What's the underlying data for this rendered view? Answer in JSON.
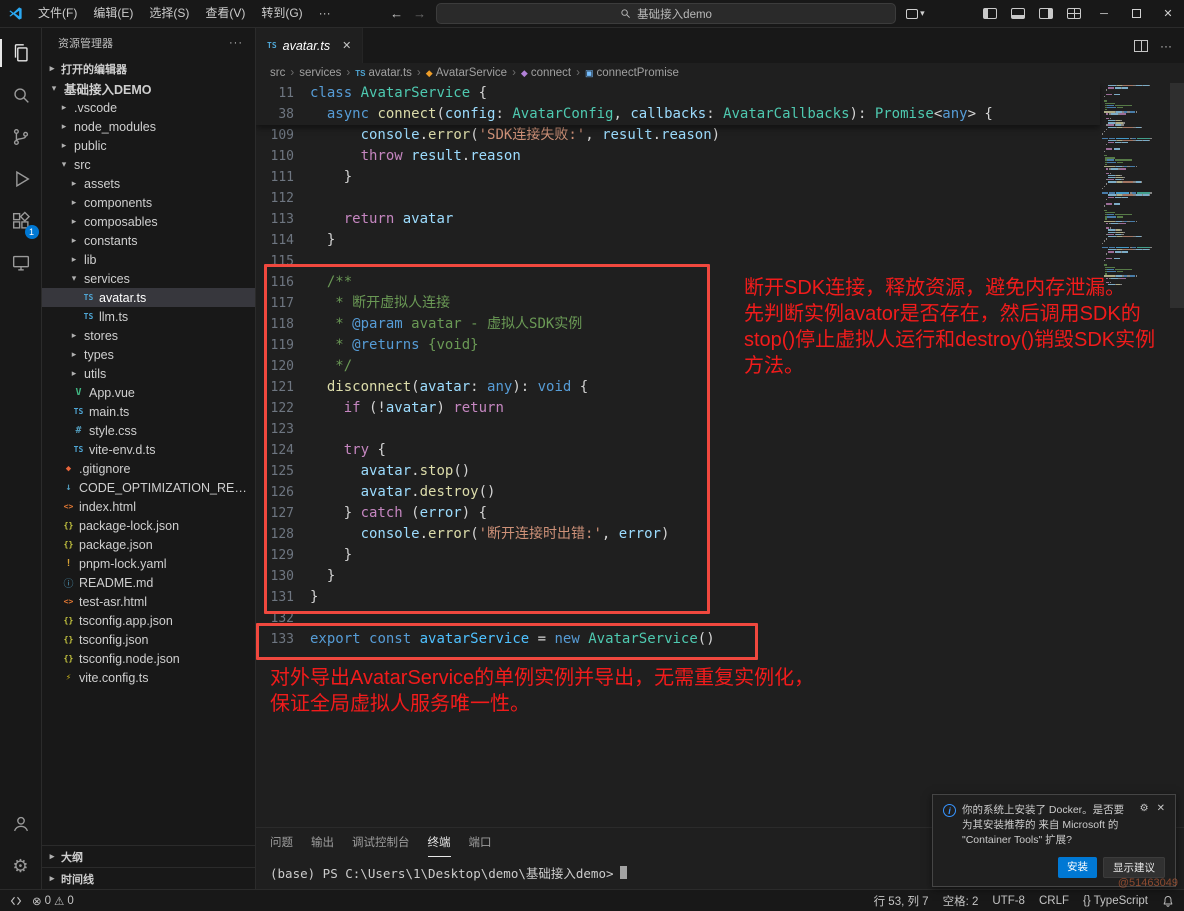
{
  "titlebar": {
    "menus": [
      "文件(F)",
      "编辑(E)",
      "选择(S)",
      "查看(V)",
      "转到(G)",
      "···"
    ],
    "search_text": "基础接入demo"
  },
  "glyphs": {
    "back": "←",
    "forward": "→",
    "more": "···",
    "close": "✕",
    "minimize": "─",
    "chev_c": "▸",
    "chev_e": "▾",
    "crumb_sep": "›",
    "err": "⊗",
    "warn": "⚠",
    "ts": "TS",
    "gear": "⚙",
    "dropdown": "▾"
  },
  "activity_bar": {
    "extensions_badge": "1"
  },
  "sidebar": {
    "title": "资源管理器",
    "open_editors_label": "打开的编辑器",
    "outline_label": "大纲",
    "timeline_label": "时间线",
    "tree": [
      {
        "label": "基础接入DEMO",
        "depth": 0,
        "kind": "folder",
        "state": "expanded",
        "bold": true
      },
      {
        "label": ".vscode",
        "depth": 1,
        "kind": "folder",
        "state": "collapsed"
      },
      {
        "label": "node_modules",
        "depth": 1,
        "kind": "folder",
        "state": "collapsed"
      },
      {
        "label": "public",
        "depth": 1,
        "kind": "folder",
        "state": "collapsed"
      },
      {
        "label": "src",
        "depth": 1,
        "kind": "folder",
        "state": "expanded"
      },
      {
        "label": "assets",
        "depth": 2,
        "kind": "folder",
        "state": "collapsed"
      },
      {
        "label": "components",
        "depth": 2,
        "kind": "folder",
        "state": "collapsed"
      },
      {
        "label": "composables",
        "depth": 2,
        "kind": "folder",
        "state": "collapsed"
      },
      {
        "label": "constants",
        "depth": 2,
        "kind": "folder",
        "state": "collapsed"
      },
      {
        "label": "lib",
        "depth": 2,
        "kind": "folder",
        "state": "collapsed"
      },
      {
        "label": "services",
        "depth": 2,
        "kind": "folder",
        "state": "expanded"
      },
      {
        "label": "avatar.ts",
        "depth": 3,
        "kind": "file",
        "icon": "ts",
        "selected": true
      },
      {
        "label": "llm.ts",
        "depth": 3,
        "kind": "file",
        "icon": "ts"
      },
      {
        "label": "stores",
        "depth": 2,
        "kind": "folder",
        "state": "collapsed"
      },
      {
        "label": "types",
        "depth": 2,
        "kind": "folder",
        "state": "collapsed"
      },
      {
        "label": "utils",
        "depth": 2,
        "kind": "folder",
        "state": "collapsed"
      },
      {
        "label": "App.vue",
        "depth": 2,
        "kind": "file",
        "icon": "vue"
      },
      {
        "label": "main.ts",
        "depth": 2,
        "kind": "file",
        "icon": "ts"
      },
      {
        "label": "style.css",
        "depth": 2,
        "kind": "file",
        "icon": "css"
      },
      {
        "label": "vite-env.d.ts",
        "depth": 2,
        "kind": "file",
        "icon": "ts"
      },
      {
        "label": ".gitignore",
        "depth": 1,
        "kind": "file",
        "icon": "git"
      },
      {
        "label": "CODE_OPTIMIZATION_REPORT.md",
        "depth": 1,
        "kind": "file",
        "icon": "md"
      },
      {
        "label": "index.html",
        "depth": 1,
        "kind": "file",
        "icon": "html"
      },
      {
        "label": "package-lock.json",
        "depth": 1,
        "kind": "file",
        "icon": "json"
      },
      {
        "label": "package.json",
        "depth": 1,
        "kind": "file",
        "icon": "json"
      },
      {
        "label": "pnpm-lock.yaml",
        "depth": 1,
        "kind": "file",
        "icon": "yaml"
      },
      {
        "label": "README.md",
        "depth": 1,
        "kind": "file",
        "icon": "readme"
      },
      {
        "label": "test-asr.html",
        "depth": 1,
        "kind": "file",
        "icon": "html"
      },
      {
        "label": "tsconfig.app.json",
        "depth": 1,
        "kind": "file",
        "icon": "json"
      },
      {
        "label": "tsconfig.json",
        "depth": 1,
        "kind": "file",
        "icon": "json"
      },
      {
        "label": "tsconfig.node.json",
        "depth": 1,
        "kind": "file",
        "icon": "json"
      },
      {
        "label": "vite.config.ts",
        "depth": 1,
        "kind": "file",
        "icon": "vite"
      }
    ]
  },
  "editor": {
    "tab": {
      "label": "avatar.ts"
    },
    "breadcrumbs": [
      {
        "label": "src"
      },
      {
        "label": "services"
      },
      {
        "label": "avatar.ts",
        "icon": "ts"
      },
      {
        "label": "AvatarService",
        "icon": "class"
      },
      {
        "label": "connect",
        "icon": "method"
      },
      {
        "label": "connectPromise",
        "icon": "field"
      }
    ],
    "sticky_lines": [
      {
        "num": "11",
        "tokens": [
          [
            "kw",
            "class"
          ],
          [
            "pln",
            " "
          ],
          [
            "type",
            "AvatarService"
          ],
          [
            "pln",
            " {"
          ]
        ]
      },
      {
        "num": "38",
        "tokens": [
          [
            "pln",
            "  "
          ],
          [
            "kw",
            "async"
          ],
          [
            "pln",
            " "
          ],
          [
            "fn",
            "connect"
          ],
          [
            "pln",
            "("
          ],
          [
            "var",
            "config"
          ],
          [
            "pln",
            ": "
          ],
          [
            "type",
            "AvatarConfig"
          ],
          [
            "pln",
            ", "
          ],
          [
            "var",
            "callbacks"
          ],
          [
            "pln",
            ": "
          ],
          [
            "type",
            "AvatarCallbacks"
          ],
          [
            "pln",
            "): "
          ],
          [
            "type",
            "Promise"
          ],
          [
            "pln",
            "<"
          ],
          [
            "kw",
            "any"
          ],
          [
            "pln",
            "> {"
          ]
        ]
      }
    ],
    "code_lines": [
      {
        "num": "109",
        "tokens": [
          [
            "pln",
            "      "
          ],
          [
            "var",
            "console"
          ],
          [
            "pln",
            "."
          ],
          [
            "fn",
            "error"
          ],
          [
            "pln",
            "("
          ],
          [
            "str",
            "'SDK连接失败:'"
          ],
          [
            "pln",
            ", "
          ],
          [
            "var",
            "result"
          ],
          [
            "pln",
            "."
          ],
          [
            "var",
            "reason"
          ],
          [
            "pln",
            ")"
          ]
        ]
      },
      {
        "num": "110",
        "tokens": [
          [
            "pln",
            "      "
          ],
          [
            "ctrl",
            "throw"
          ],
          [
            "pln",
            " "
          ],
          [
            "var",
            "result"
          ],
          [
            "pln",
            "."
          ],
          [
            "var",
            "reason"
          ]
        ]
      },
      {
        "num": "111",
        "tokens": [
          [
            "pln",
            "    }"
          ]
        ]
      },
      {
        "num": "112",
        "tokens": []
      },
      {
        "num": "113",
        "tokens": [
          [
            "pln",
            "    "
          ],
          [
            "ctrl",
            "return"
          ],
          [
            "pln",
            " "
          ],
          [
            "var",
            "avatar"
          ]
        ]
      },
      {
        "num": "114",
        "tokens": [
          [
            "pln",
            "  }"
          ]
        ]
      },
      {
        "num": "115",
        "tokens": []
      },
      {
        "num": "116",
        "tokens": [
          [
            "cmt",
            "  /**"
          ]
        ]
      },
      {
        "num": "117",
        "tokens": [
          [
            "cmt",
            "   * 断开虚拟人连接"
          ]
        ]
      },
      {
        "num": "118",
        "tokens": [
          [
            "cmt",
            "   * "
          ],
          [
            "tag",
            "@param"
          ],
          [
            "cmt",
            " avatar - 虚拟人SDK实例"
          ]
        ]
      },
      {
        "num": "119",
        "tokens": [
          [
            "cmt",
            "   * "
          ],
          [
            "tag",
            "@returns"
          ],
          [
            "cmt",
            " {void}"
          ]
        ]
      },
      {
        "num": "120",
        "tokens": [
          [
            "cmt",
            "   */"
          ]
        ]
      },
      {
        "num": "121",
        "tokens": [
          [
            "pln",
            "  "
          ],
          [
            "fn",
            "disconnect"
          ],
          [
            "pln",
            "("
          ],
          [
            "var",
            "avatar"
          ],
          [
            "pln",
            ": "
          ],
          [
            "kw",
            "any"
          ],
          [
            "pln",
            "): "
          ],
          [
            "kw",
            "void"
          ],
          [
            "pln",
            " {"
          ]
        ]
      },
      {
        "num": "122",
        "tokens": [
          [
            "pln",
            "    "
          ],
          [
            "ctrl",
            "if"
          ],
          [
            "pln",
            " (!"
          ],
          [
            "var",
            "avatar"
          ],
          [
            "pln",
            ") "
          ],
          [
            "ctrl",
            "return"
          ]
        ]
      },
      {
        "num": "123",
        "tokens": []
      },
      {
        "num": "124",
        "tokens": [
          [
            "pln",
            "    "
          ],
          [
            "ctrl",
            "try"
          ],
          [
            "pln",
            " {"
          ]
        ]
      },
      {
        "num": "125",
        "tokens": [
          [
            "pln",
            "      "
          ],
          [
            "var",
            "avatar"
          ],
          [
            "pln",
            "."
          ],
          [
            "fn",
            "stop"
          ],
          [
            "pln",
            "()"
          ]
        ]
      },
      {
        "num": "126",
        "tokens": [
          [
            "pln",
            "      "
          ],
          [
            "var",
            "avatar"
          ],
          [
            "pln",
            "."
          ],
          [
            "fn",
            "destroy"
          ],
          [
            "pln",
            "()"
          ]
        ]
      },
      {
        "num": "127",
        "tokens": [
          [
            "pln",
            "    } "
          ],
          [
            "ctrl",
            "catch"
          ],
          [
            "pln",
            " ("
          ],
          [
            "var",
            "error"
          ],
          [
            "pln",
            ") {"
          ]
        ]
      },
      {
        "num": "128",
        "tokens": [
          [
            "pln",
            "      "
          ],
          [
            "var",
            "console"
          ],
          [
            "pln",
            "."
          ],
          [
            "fn",
            "error"
          ],
          [
            "pln",
            "("
          ],
          [
            "str",
            "'断开连接时出错:'"
          ],
          [
            "pln",
            ", "
          ],
          [
            "var",
            "error"
          ],
          [
            "pln",
            ")"
          ]
        ]
      },
      {
        "num": "129",
        "tokens": [
          [
            "pln",
            "    }"
          ]
        ]
      },
      {
        "num": "130",
        "tokens": [
          [
            "pln",
            "  }"
          ]
        ]
      },
      {
        "num": "131",
        "tokens": [
          [
            "pln",
            "}"
          ]
        ]
      },
      {
        "num": "132",
        "tokens": []
      },
      {
        "num": "133",
        "tokens": [
          [
            "kw",
            "export"
          ],
          [
            "pln",
            " "
          ],
          [
            "kw",
            "const"
          ],
          [
            "pln",
            " "
          ],
          [
            "cvar",
            "avatarService"
          ],
          [
            "pln",
            " = "
          ],
          [
            "kw",
            "new"
          ],
          [
            "pln",
            " "
          ],
          [
            "type",
            "AvatarService"
          ],
          [
            "pln",
            "()"
          ]
        ]
      }
    ]
  },
  "annotations": {
    "note1_lines": [
      "断开SDK连接，释放资源，避免内存泄漏。",
      "先判断实例avator是否存在，然后调用SDK的",
      "stop()停止虚拟人运行和destroy()销毁SDK实例",
      "方法。"
    ],
    "note2_lines": [
      "对外导出AvatarService的单例实例并导出，无需重复实例化，",
      "保证全局虚拟人服务唯一性。"
    ]
  },
  "panel": {
    "tabs": [
      "问题",
      "输出",
      "调试控制台",
      "终端",
      "端口"
    ],
    "active_tab": "终端",
    "terminal_line": "(base) PS C:\\Users\\1\\Desktop\\demo\\基础接入demo>"
  },
  "notification": {
    "message": "你的系统上安装了 Docker。是否要为其安装推荐的 来自 Microsoft 的 \"Container Tools\" 扩展?",
    "install_label": "安装",
    "recommend_label": "显示建议"
  },
  "statusbar": {
    "errors": "0",
    "warnings": "0",
    "right_items": [
      "行 53, 列 7",
      "空格: 2",
      "UTF-8",
      "CRLF",
      "{} TypeScript"
    ]
  },
  "watermark": "@51463049",
  "colors": {
    "accent": "#0078d4",
    "annotation_red": "#f21b1b",
    "annotation_box": "#f0483e"
  }
}
